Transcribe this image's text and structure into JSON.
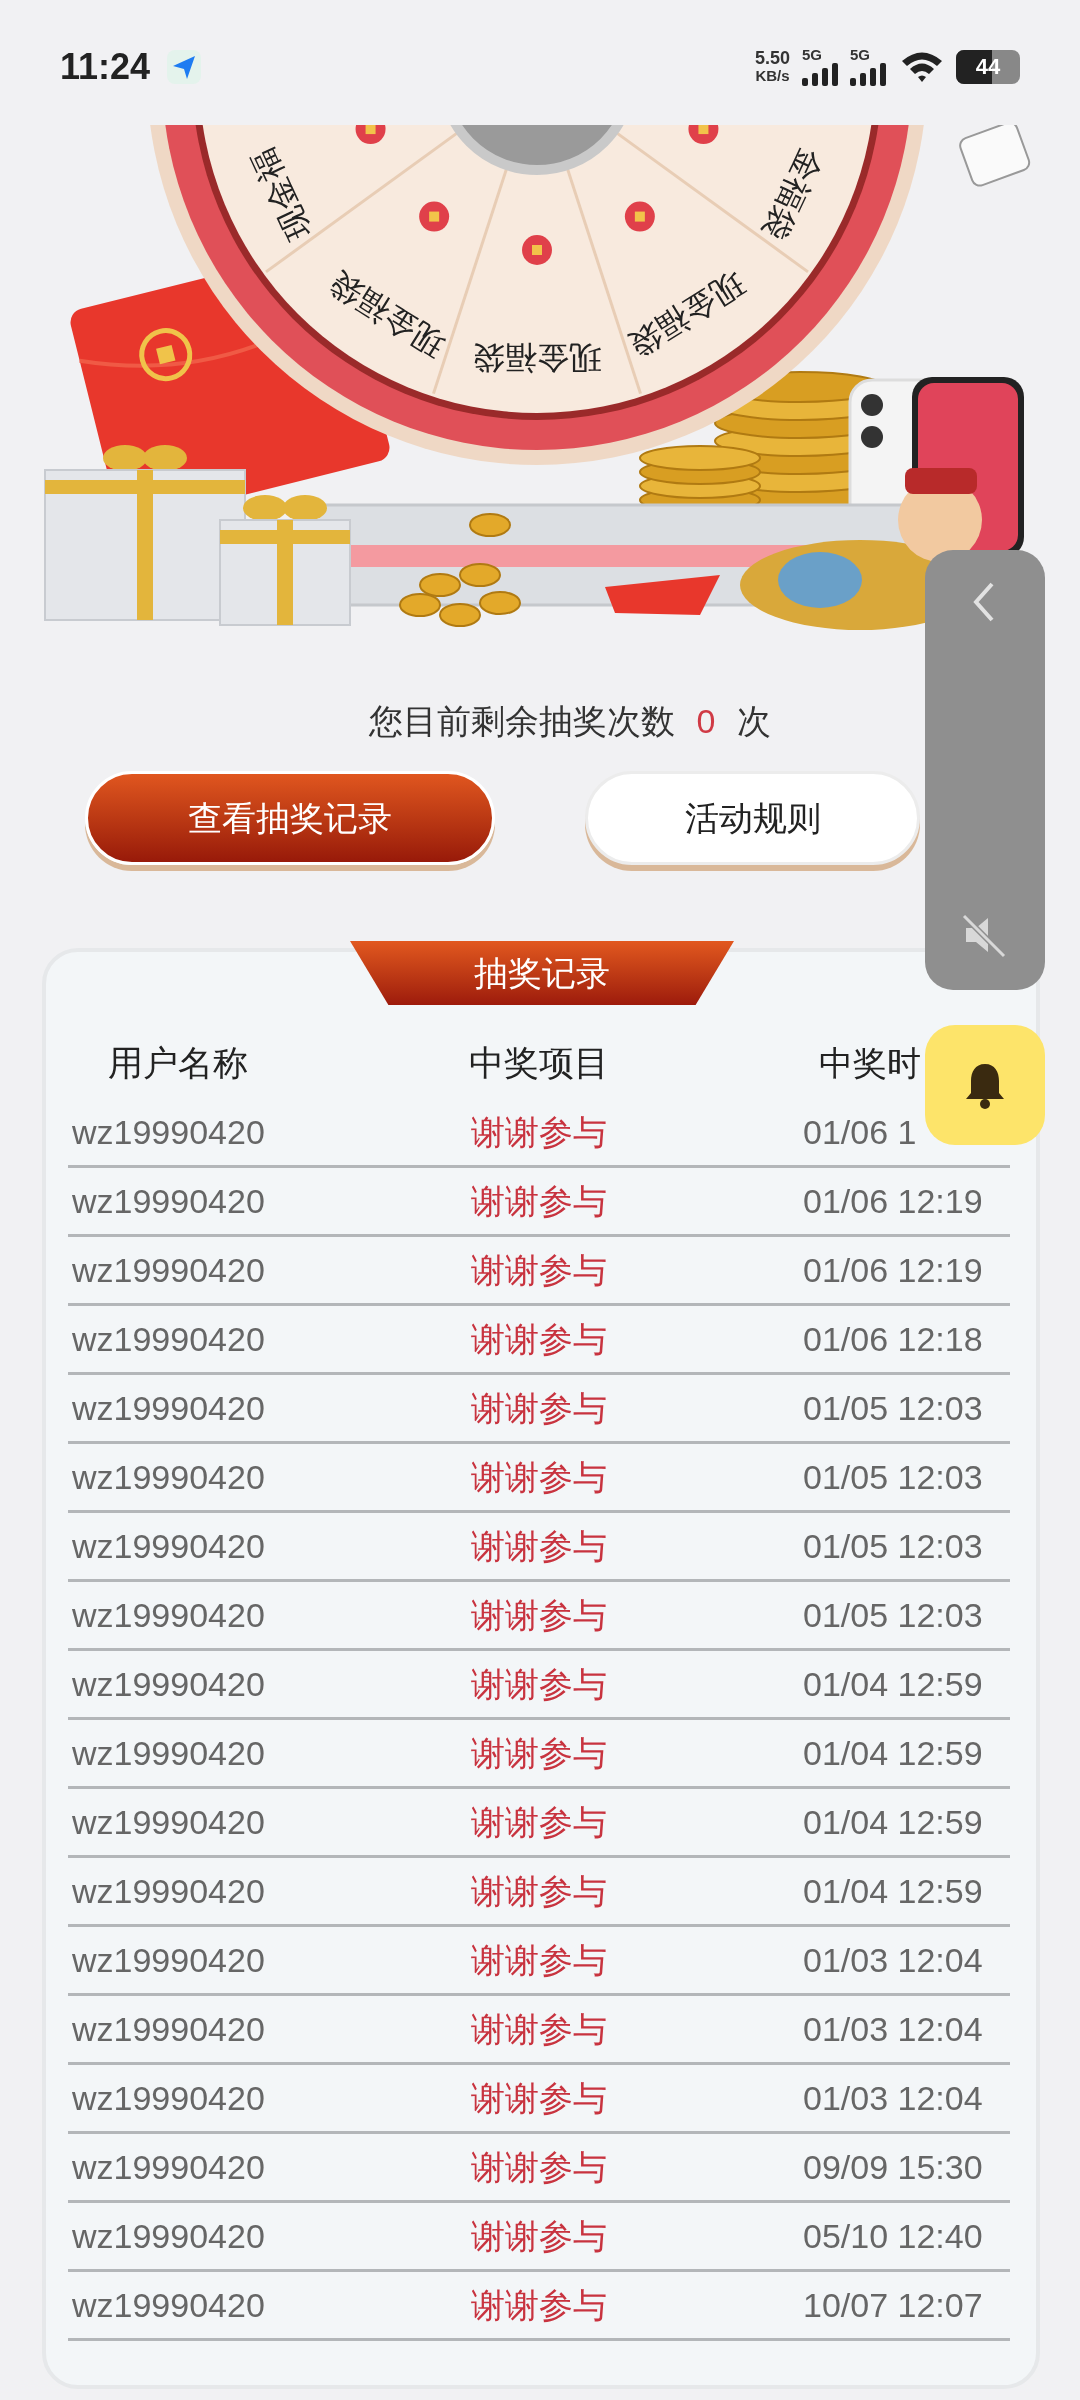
{
  "status_bar": {
    "time": "11:24",
    "net_speed": "5.50",
    "net_speed_unit": "KB/s",
    "signals": [
      {
        "label": "5G"
      },
      {
        "label": "5G"
      }
    ],
    "battery": "44"
  },
  "wheel": {
    "labels": [
      "现金福",
      "现金福袋",
      "现金福袋",
      "现金福袋",
      "金福袋"
    ]
  },
  "remaining": {
    "prefix": "您目前剩余抽奖次数",
    "count": "0",
    "suffix": "次"
  },
  "buttons": [
    {
      "label": "查看抽奖记录",
      "kind": "primary"
    },
    {
      "label": "活动规则",
      "kind": "secondary"
    }
  ],
  "records": {
    "title": "抽奖记录",
    "columns": [
      "用户名称",
      "中奖项目",
      "中奖时"
    ],
    "rows": [
      [
        "wz19990420",
        "谢谢参与",
        "01/06 1"
      ],
      [
        "wz19990420",
        "谢谢参与",
        "01/06 12:19"
      ],
      [
        "wz19990420",
        "谢谢参与",
        "01/06 12:19"
      ],
      [
        "wz19990420",
        "谢谢参与",
        "01/06 12:18"
      ],
      [
        "wz19990420",
        "谢谢参与",
        "01/05 12:03"
      ],
      [
        "wz19990420",
        "谢谢参与",
        "01/05 12:03"
      ],
      [
        "wz19990420",
        "谢谢参与",
        "01/05 12:03"
      ],
      [
        "wz19990420",
        "谢谢参与",
        "01/05 12:03"
      ],
      [
        "wz19990420",
        "谢谢参与",
        "01/04 12:59"
      ],
      [
        "wz19990420",
        "谢谢参与",
        "01/04 12:59"
      ],
      [
        "wz19990420",
        "谢谢参与",
        "01/04 12:59"
      ],
      [
        "wz19990420",
        "谢谢参与",
        "01/04 12:59"
      ],
      [
        "wz19990420",
        "谢谢参与",
        "01/03 12:04"
      ],
      [
        "wz19990420",
        "谢谢参与",
        "01/03 12:04"
      ],
      [
        "wz19990420",
        "谢谢参与",
        "01/03 12:04"
      ],
      [
        "wz19990420",
        "谢谢参与",
        "09/09 15:30"
      ],
      [
        "wz19990420",
        "谢谢参与",
        "05/10 12:40"
      ],
      [
        "wz19990420",
        "谢谢参与",
        "10/07 12:07"
      ]
    ]
  }
}
